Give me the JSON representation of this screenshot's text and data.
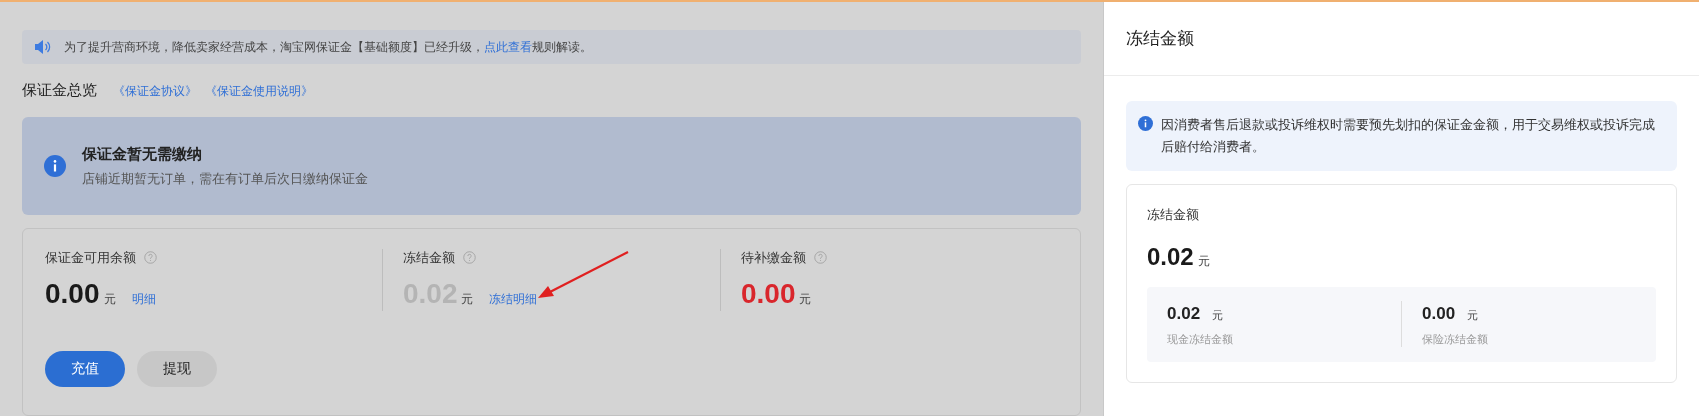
{
  "notice": {
    "text": "为了提升营商环境，降低卖家经营成本，淘宝网保证金【基础额度】已经升级，",
    "link": "点此查看",
    "suffix": "规则解读。"
  },
  "overview": {
    "title": "保证金总览",
    "links": [
      "《保证金协议》",
      "《保证金使用说明》"
    ]
  },
  "status_card": {
    "title": "保证金暂无需缴纳",
    "description": "店铺近期暂无订单，需在有订单后次日缴纳保证金"
  },
  "metrics": [
    {
      "label": "保证金可用余额",
      "value": "0.00",
      "unit": "元",
      "link": "明细",
      "color": "#1a1a1a"
    },
    {
      "label": "冻结金额",
      "value": "0.02",
      "unit": "元",
      "link": "冻结明细",
      "color": "#b4b4b4"
    },
    {
      "label": "待补缴金额",
      "value": "0.00",
      "unit": "元",
      "color": "#d9262c"
    }
  ],
  "actions": [
    {
      "label": "充值",
      "kind": "primary"
    },
    {
      "label": "提现",
      "kind": "secondary"
    }
  ],
  "drawer": {
    "title": "冻结金额",
    "note": "因消费者售后退款或投诉维权时需要预先划扣的保证金金额，用于交易维权或投诉完成后赔付给消费者。",
    "card": {
      "label": "冻结金额",
      "value": "0.02",
      "unit": "元",
      "breakdown": [
        {
          "value": "0.02",
          "unit": "元",
          "label": "现金冻结金额"
        },
        {
          "value": "0.00",
          "unit": "元",
          "label": "保险冻结金额"
        }
      ]
    }
  }
}
